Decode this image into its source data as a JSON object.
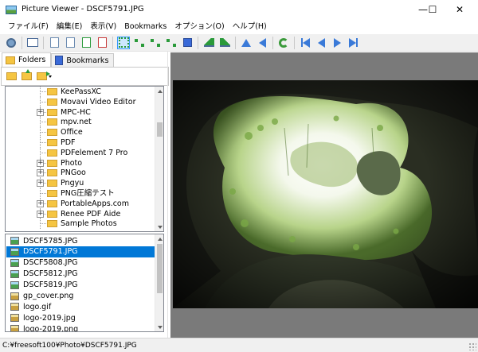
{
  "window": {
    "title": "Picture Viewer - DSCF5791.JPG",
    "minimize": "—",
    "maximize": "☐",
    "close": "✕"
  },
  "menu": [
    "ファイル(F)",
    "編集(E)",
    "表示(V)",
    "Bookmarks",
    "オプション(O)",
    "ヘルプ(H)"
  ],
  "tabs": {
    "folders": "Folders",
    "bookmarks": "Bookmarks"
  },
  "tree": {
    "items": [
      {
        "label": "KeePassXC",
        "expandable": false
      },
      {
        "label": "Movavi Video Editor",
        "expandable": false
      },
      {
        "label": "MPC-HC",
        "expandable": true
      },
      {
        "label": "mpv.net",
        "expandable": false
      },
      {
        "label": "Office",
        "expandable": false
      },
      {
        "label": "PDF",
        "expandable": false
      },
      {
        "label": "PDFelement 7 Pro",
        "expandable": false
      },
      {
        "label": "Photo",
        "expandable": true
      },
      {
        "label": "PNGoo",
        "expandable": true
      },
      {
        "label": "Pngyu",
        "expandable": true
      },
      {
        "label": "PNG圧縮テスト",
        "expandable": false
      },
      {
        "label": "PortableApps.com",
        "expandable": true
      },
      {
        "label": "Renee PDF Aide",
        "expandable": true
      },
      {
        "label": "Sample Photos",
        "expandable": false
      }
    ]
  },
  "files": {
    "selected_index": 1,
    "items": [
      {
        "name": "DSCF5785.JPG",
        "kind": "photo"
      },
      {
        "name": "DSCF5791.JPG",
        "kind": "photo"
      },
      {
        "name": "DSCF5808.JPG",
        "kind": "photo"
      },
      {
        "name": "DSCF5812.JPG",
        "kind": "photo"
      },
      {
        "name": "DSCF5819.JPG",
        "kind": "photo"
      },
      {
        "name": "gp_cover.png",
        "kind": "other"
      },
      {
        "name": "logo.gif",
        "kind": "other"
      },
      {
        "name": "logo-2019.jpg",
        "kind": "other"
      },
      {
        "name": "logo-2019.png",
        "kind": "other"
      }
    ]
  },
  "status": {
    "path": "C:¥freesoft100¥Photo¥DSCF5791.JPG"
  },
  "colors": {
    "selection": "#0078d7",
    "viewer_bg": "#7a7a7a"
  }
}
